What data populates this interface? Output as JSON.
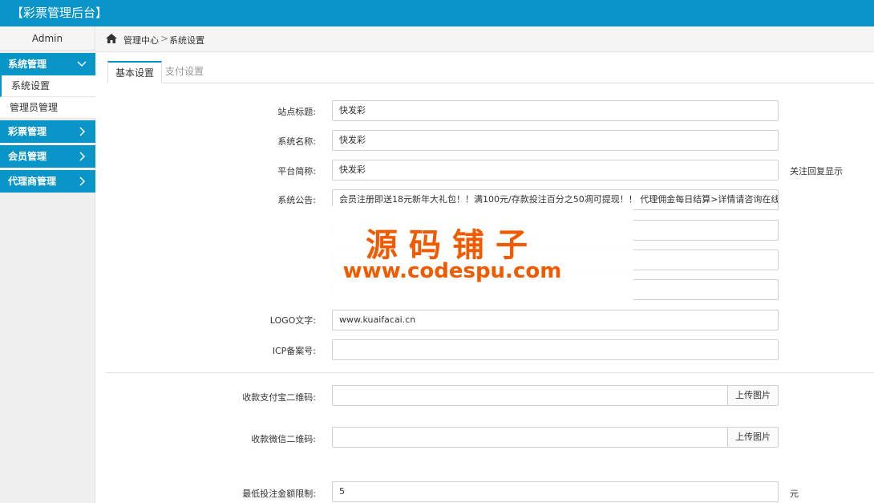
{
  "app": {
    "title": "【彩票管理后台】"
  },
  "sidebar": {
    "user": "Admin",
    "groups": [
      {
        "label": "系统管理",
        "expanded": true,
        "items": [
          {
            "label": "系统设置"
          },
          {
            "label": "管理员管理"
          }
        ]
      },
      {
        "label": "彩票管理",
        "expanded": false
      },
      {
        "label": "会员管理",
        "expanded": false
      },
      {
        "label": "代理商管理",
        "expanded": false
      }
    ]
  },
  "breadcrumb": {
    "items": [
      "管理中心",
      "系统设置"
    ],
    "separator": ">"
  },
  "tabs": [
    {
      "label": "基本设置",
      "active": true
    },
    {
      "label": "支付设置",
      "active": false
    }
  ],
  "form": {
    "site_title": {
      "label": "站点标题:",
      "value": "快发彩"
    },
    "system_name": {
      "label": "系统名称:",
      "value": "快发彩"
    },
    "platform_abbr": {
      "label": "平台简称:",
      "value": "快发彩",
      "note": "关注回复显示"
    },
    "system_notice": {
      "label": "系统公告:",
      "value": "会员注册即送18元新年大礼包！！满100元/存款投注百分之50凋可提现！！ 代理佣金每日结算>详情请咨询在线客服"
    },
    "logo_text": {
      "label": "LOGO文字:",
      "value": "www.kuaifacai.cn"
    },
    "icp": {
      "label": "ICP备案号:",
      "value": ""
    },
    "alipay_qr": {
      "label": "收款支付宝二维码:",
      "value": "",
      "button": "上传图片"
    },
    "wechat_qr": {
      "label": "收款微信二维码:",
      "value": "",
      "button": "上传图片"
    },
    "min_bet": {
      "label": "最低投注金额限制:",
      "value": "5",
      "unit": "元"
    }
  },
  "watermark": {
    "line1": "源码铺子",
    "line2": "www.codespu.com"
  },
  "colors": {
    "primary": "#0a95c9",
    "watermark": "#f05a00"
  }
}
